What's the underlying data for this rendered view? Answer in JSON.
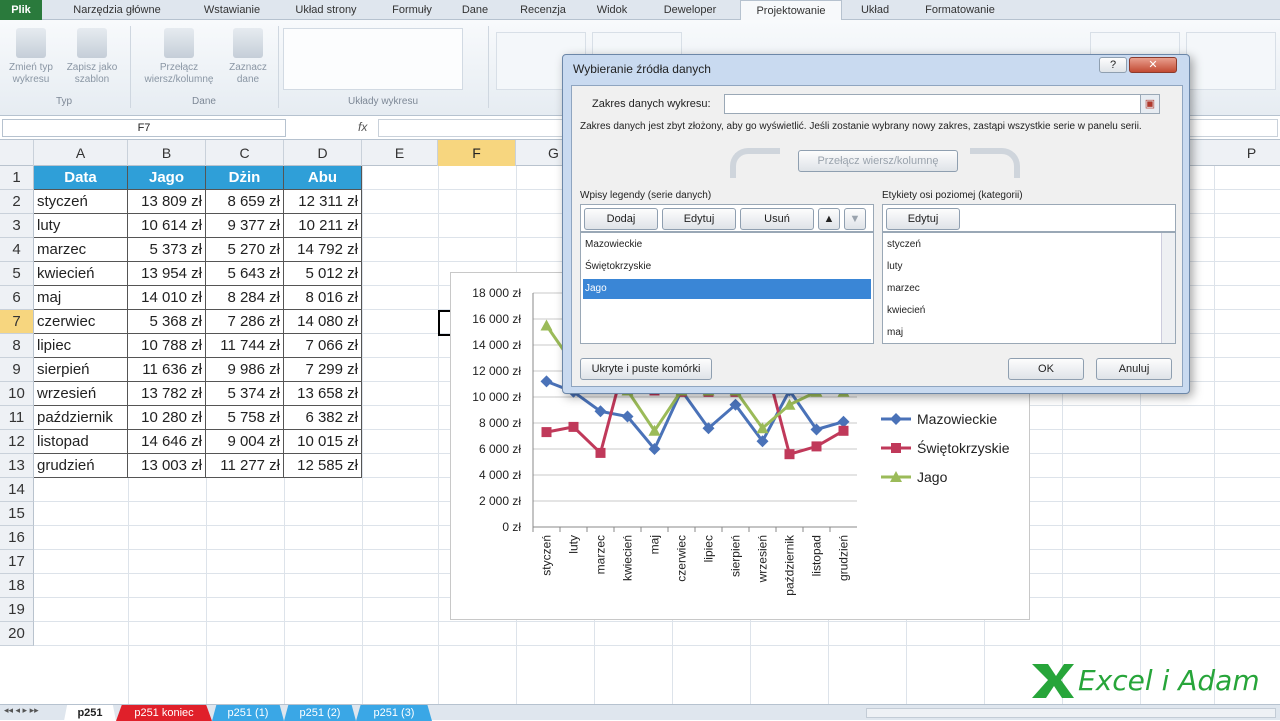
{
  "ribbon": {
    "tabs": [
      "Plik",
      "Narzędzia główne",
      "Wstawianie",
      "Układ strony",
      "Formuły",
      "Dane",
      "Recenzja",
      "Widok",
      "Deweloper",
      "Projektowanie",
      "Układ",
      "Formatowanie"
    ],
    "buttons": [
      {
        "label": "Zmień typ wykresu"
      },
      {
        "label": "Zapisz jako szablon"
      },
      {
        "label": "Przełącz wiersz/kolumnę"
      },
      {
        "label": "Zaznacz dane"
      }
    ],
    "groups": [
      "Typ",
      "Dane",
      "Układy wykresu"
    ]
  },
  "formula_bar": {
    "name_box": "F7",
    "fx": "fx"
  },
  "grid": {
    "columns": [
      "A",
      "B",
      "C",
      "D",
      "E",
      "F",
      "G",
      "P"
    ],
    "rows": [
      "1",
      "2",
      "3",
      "4",
      "5",
      "6",
      "7",
      "8",
      "9",
      "10",
      "11",
      "12",
      "13",
      "14",
      "15",
      "16",
      "17",
      "18",
      "19",
      "20"
    ],
    "header": [
      "Data",
      "Jago",
      "Dżin",
      "Abu"
    ],
    "data": [
      [
        "styczeń",
        "13 809 zł",
        "8 659 zł",
        "12 311 zł"
      ],
      [
        "luty",
        "10 614 zł",
        "9 377 zł",
        "10 211 zł"
      ],
      [
        "marzec",
        "5 373 zł",
        "5 270 zł",
        "14 792 zł"
      ],
      [
        "kwiecień",
        "13 954 zł",
        "5 643 zł",
        "5 012 zł"
      ],
      [
        "maj",
        "14 010 zł",
        "8 284 zł",
        "8 016 zł"
      ],
      [
        "czerwiec",
        "5 368 zł",
        "7 286 zł",
        "14 080 zł"
      ],
      [
        "lipiec",
        "10 788 zł",
        "11 744 zł",
        "7 066 zł"
      ],
      [
        "sierpień",
        "11 636 zł",
        "9 986 zł",
        "7 299 zł"
      ],
      [
        "wrzesień",
        "13 782 zł",
        "5 374 zł",
        "13 658 zł"
      ],
      [
        "październik",
        "10 280 zł",
        "5 758 zł",
        "6 382 zł"
      ],
      [
        "listopad",
        "14 646 zł",
        "9 004 zł",
        "10 015 zł"
      ],
      [
        "grudzień",
        "13 003 zł",
        "11 277 zł",
        "12 585 zł"
      ]
    ]
  },
  "chart_data": {
    "type": "line",
    "categories": [
      "styczeń",
      "luty",
      "marzec",
      "kwiecień",
      "maj",
      "czerwiec",
      "lipiec",
      "sierpień",
      "wrzesień",
      "październik",
      "listopad",
      "grudzień"
    ],
    "yticks": [
      "18 000 zł",
      "16 000 zł",
      "14 000 zł",
      "12 000 zł",
      "10 000 zł",
      "8 000 zł",
      "6 000 zł",
      "4 000 zł",
      "2 000 zł",
      "0 zł"
    ],
    "ylim": [
      0,
      18000
    ],
    "series": [
      {
        "name": "Mazowieckie",
        "color": "#4a72b8",
        "values": [
          11200,
          10400,
          8900,
          8500,
          6000,
          10500,
          7600,
          9400,
          6600,
          10500,
          7500,
          8100
        ]
      },
      {
        "name": "Świętokrzyskie",
        "color": "#c0395a",
        "values": [
          7300,
          7700,
          5700,
          13500,
          10500,
          10400,
          10400,
          10400,
          13500,
          5600,
          6200,
          7400
        ]
      },
      {
        "name": "Jago",
        "color": "#9bbb59",
        "values": [
          15500,
          12500,
          10800,
          10500,
          7400,
          10500,
          10500,
          10500,
          7600,
          9400,
          10400,
          10400
        ]
      }
    ]
  },
  "dialog": {
    "title": "Wybieranie źródła danych",
    "range_label": "Zakres danych wykresu:",
    "range_value": "",
    "warning": "Zakres danych jest zbyt złożony, aby go wyświetlić. Jeśli zostanie wybrany nowy zakres, zastąpi wszystkie serie w panelu serii.",
    "switch_label": "Przełącz wiersz/kolumnę",
    "legend_label": "Wpisy legendy (serie danych)",
    "add_label": "Dodaj",
    "edit_label": "Edytuj",
    "remove_label": "Usuń",
    "axis_label": "Etykiety osi poziomej (kategorii)",
    "axis_edit_label": "Edytuj",
    "series_items": [
      "Mazowieckie",
      "Świętokrzyskie",
      "Jago"
    ],
    "category_items": [
      "styczeń",
      "luty",
      "marzec",
      "kwiecień",
      "maj"
    ],
    "hidden_label": "Ukryte i puste komórki",
    "ok_label": "OK",
    "cancel_label": "Anuluj",
    "help": "?",
    "close": "✕"
  },
  "sheets": [
    "p251",
    "p251 koniec",
    "p251 (1)",
    "p251 (2)",
    "p251 (3)"
  ],
  "watermark": "Excel i Adam"
}
